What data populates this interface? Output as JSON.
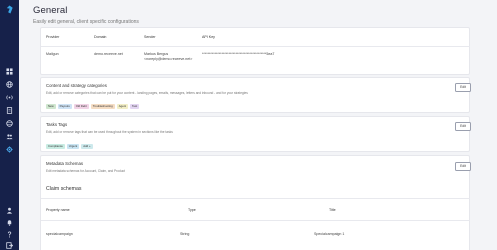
{
  "header": {
    "title": "General",
    "subtitle": "Easily edit general, client specific configurations"
  },
  "sidebar": {
    "icons": [
      "logo-icon",
      "dashboard-icon",
      "globe-icon",
      "broadcast-icon",
      "document-icon",
      "settings-globe-icon",
      "users-icon",
      "gear-icon",
      "user-icon",
      "bell-icon",
      "help-icon",
      "logout-icon"
    ]
  },
  "email_providers": {
    "columns": [
      "Provider",
      "Domain",
      "Sender",
      "API Key"
    ],
    "rows": [
      {
        "provider": "Mailgun",
        "domain": "demo.receeve.net",
        "sender_name": "Markus Bergus",
        "sender_email": "<noreply@demo.receeve.net>",
        "api_key": "**********************************************5ea7"
      }
    ]
  },
  "content_categories": {
    "title": "Content and strategy categories",
    "description": "Edit, add or remove categories that can be put for your content - landing pages, emails, messages, letters and inbound - and for your strategies",
    "edit_label": "Edit",
    "tags": [
      {
        "label": "New",
        "color": "#cfe6cf"
      },
      {
        "label": "Payouts",
        "color": "#cfe3f5"
      },
      {
        "label": "Old Debt",
        "color": "#f1d3e6"
      },
      {
        "label": "Troubleshooting",
        "color": "#f5ddc4"
      },
      {
        "label": "Agent",
        "color": "#f2eec6"
      },
      {
        "label": "Test",
        "color": "#e3d5f2"
      }
    ]
  },
  "tasks_tags": {
    "title": "Tasks Tags",
    "description": "Edit, add or remove tags that can be used throughout the system in sections like the tasks",
    "edit_label": "Edit",
    "tags": [
      {
        "label": "Compliance",
        "color": "#c9ece3"
      },
      {
        "label": "Urgent",
        "color": "#c8e4f2"
      },
      {
        "label": "Add +",
        "color": "#cde9ec"
      }
    ]
  },
  "metadata_schemas": {
    "title": "Metadata Schemas",
    "description": "Edit metadata schemas for Account, Claim, and Product",
    "edit_label": "Edit",
    "claim_schemas_title": "Claim schemas",
    "columns": [
      "Property name",
      "Type",
      "Title"
    ],
    "rows": [
      {
        "property": "specialcampaign",
        "type": "String",
        "title": "Specialcampaign 1"
      }
    ]
  }
}
